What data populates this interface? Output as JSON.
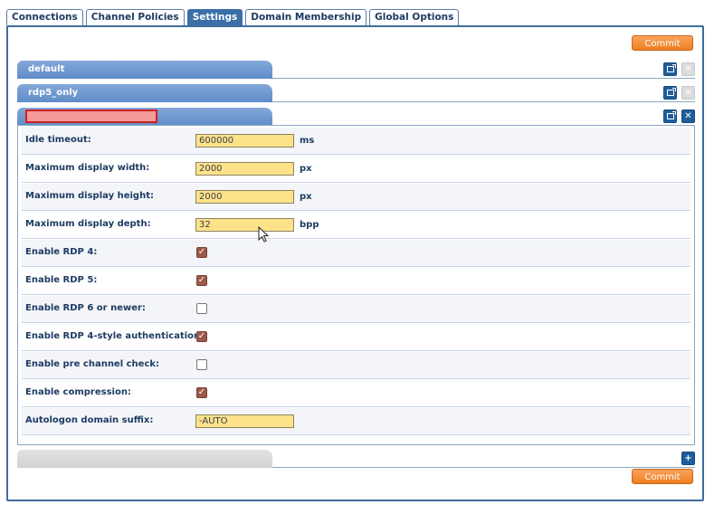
{
  "tabs": [
    {
      "label": "Connections"
    },
    {
      "label": "Channel Policies"
    },
    {
      "label": "Settings"
    },
    {
      "label": "Domain Membership"
    },
    {
      "label": "Global Options"
    }
  ],
  "active_tab": "Settings",
  "commit_label": "Commit",
  "channels": [
    {
      "name": "default",
      "icon": "edit-icon",
      "delete_enabled": false
    },
    {
      "name": "rdp5_only",
      "icon": "edit-icon",
      "delete_enabled": false
    },
    {
      "name": "",
      "icon": "collapse-icon",
      "delete_enabled": true
    }
  ],
  "settings": [
    {
      "label": "Idle timeout:",
      "type": "text",
      "value": "600000",
      "unit": "ms"
    },
    {
      "label": "Maximum display width:",
      "type": "text",
      "value": "2000",
      "unit": "px"
    },
    {
      "label": "Maximum display height:",
      "type": "text",
      "value": "2000",
      "unit": "px"
    },
    {
      "label": "Maximum display depth:",
      "type": "text",
      "value": "32",
      "unit": "bpp"
    },
    {
      "label": "Enable RDP 4:",
      "type": "checkbox",
      "checked": true
    },
    {
      "label": "Enable RDP 5:",
      "type": "checkbox",
      "checked": true
    },
    {
      "label": "Enable RDP 6 or newer:",
      "type": "checkbox",
      "checked": false
    },
    {
      "label": "Enable RDP 4-style authentication:",
      "type": "checkbox",
      "checked": true
    },
    {
      "label": "Enable pre channel check:",
      "type": "checkbox",
      "checked": false
    },
    {
      "label": "Enable compression:",
      "type": "checkbox",
      "checked": true
    },
    {
      "label": "Autologon domain suffix:",
      "type": "text",
      "value": "-AUTO",
      "unit": ""
    }
  ],
  "colors": {
    "accent": "#3a6fa8",
    "commit": "#ef7f1f",
    "input_fill": "#fde28a",
    "error_input": "#f59a9a"
  }
}
